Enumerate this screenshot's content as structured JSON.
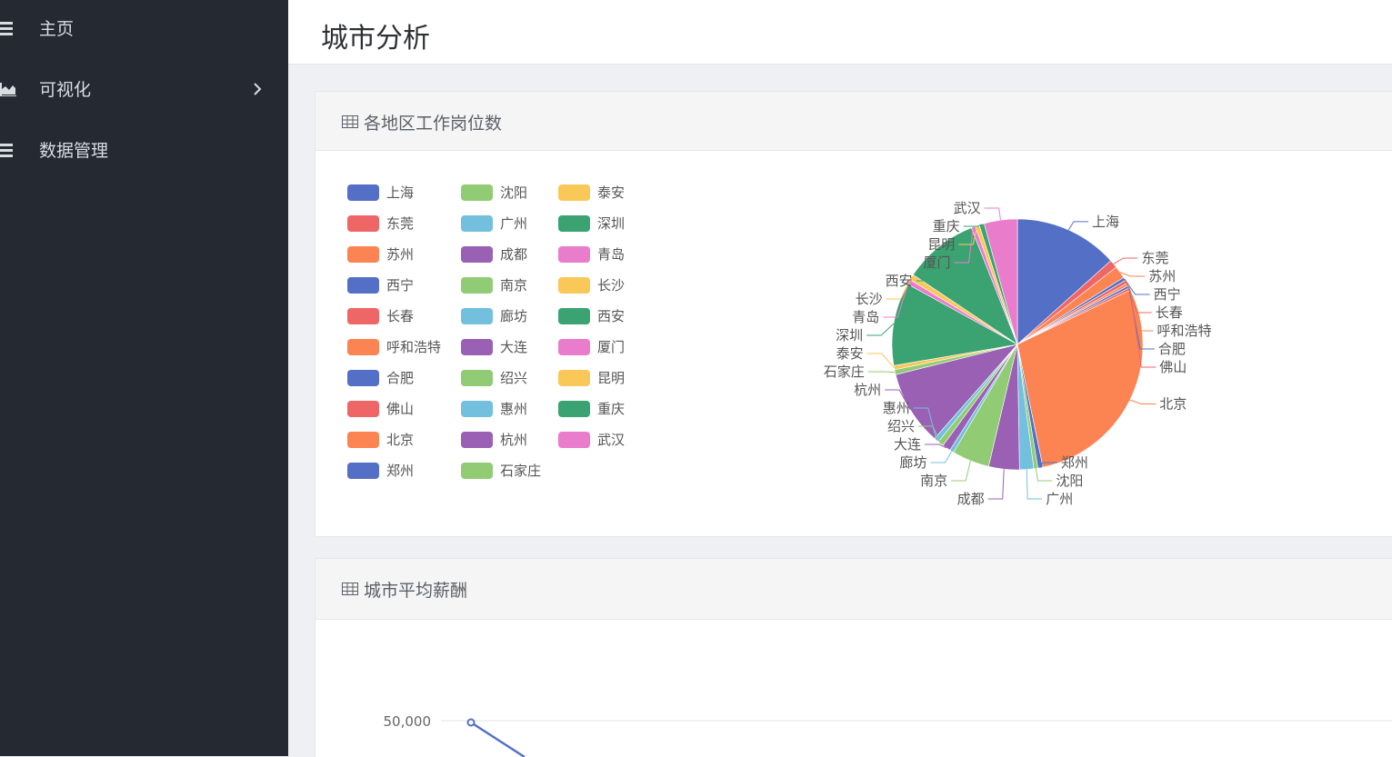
{
  "sidebar": {
    "items": [
      {
        "label": "主页",
        "icon": "menu-icon"
      },
      {
        "label": "可视化",
        "icon": "area-chart-icon",
        "has_submenu": true
      },
      {
        "label": "数据管理",
        "icon": "menu-icon"
      }
    ]
  },
  "header": {
    "title": "城市分析"
  },
  "panels": [
    {
      "title": "各地区工作岗位数",
      "icon": "table-icon"
    },
    {
      "title": "城市平均薪酬",
      "icon": "table-icon"
    }
  ],
  "colors": {
    "sidebar_bg": "#252a32",
    "palette": [
      "#5470c6",
      "#91cc75",
      "#fac858",
      "#ee6666",
      "#73c0de",
      "#3ba272",
      "#fc8452",
      "#9a60b4",
      "#ea7ccc"
    ]
  },
  "chart_data": [
    {
      "type": "pie",
      "legend_position": "left",
      "legend": [
        "上海",
        "沈阳",
        "泰安",
        "东莞",
        "广州",
        "深圳",
        "苏州",
        "成都",
        "青岛",
        "西宁",
        "南京",
        "长沙",
        "长春",
        "廊坊",
        "西安",
        "呼和浩特",
        "大连",
        "厦门",
        "合肥",
        "绍兴",
        "昆明",
        "佛山",
        "惠州",
        "重庆",
        "北京",
        "杭州",
        "武汉",
        "郑州",
        "石家庄"
      ],
      "slices": [
        {
          "name": "上海",
          "value": 12.5
        },
        {
          "name": "东莞",
          "value": 1
        },
        {
          "name": "苏州",
          "value": 1.5
        },
        {
          "name": "西宁",
          "value": 0.4
        },
        {
          "name": "长春",
          "value": 0.4
        },
        {
          "name": "呼和浩特",
          "value": 0.3
        },
        {
          "name": "合肥",
          "value": 0.3
        },
        {
          "name": "佛山",
          "value": 0.3
        },
        {
          "name": "北京",
          "value": 27
        },
        {
          "name": "郑州",
          "value": 0.6
        },
        {
          "name": "沈阳",
          "value": 0.5
        },
        {
          "name": "广州",
          "value": 1.7
        },
        {
          "name": "成都",
          "value": 3.7
        },
        {
          "name": "南京",
          "value": 4.5
        },
        {
          "name": "廊坊",
          "value": 0.5
        },
        {
          "name": "大连",
          "value": 1
        },
        {
          "name": "绍兴",
          "value": 0.7
        },
        {
          "name": "惠州",
          "value": 0.6
        },
        {
          "name": "杭州",
          "value": 9
        },
        {
          "name": "石家庄",
          "value": 0.6
        },
        {
          "name": "泰安",
          "value": 0.5
        },
        {
          "name": "深圳",
          "value": 10
        },
        {
          "name": "青岛",
          "value": 0.6
        },
        {
          "name": "长沙",
          "value": 0.7
        },
        {
          "name": "西安",
          "value": 9
        },
        {
          "name": "厦门",
          "value": 0.5
        },
        {
          "name": "昆明",
          "value": 0.5
        },
        {
          "name": "重庆",
          "value": 0.6
        },
        {
          "name": "武汉",
          "value": 4
        }
      ]
    },
    {
      "type": "line",
      "y_tick_labels": [
        "50,000"
      ],
      "series": [
        {
          "values": [
            50000
          ]
        }
      ]
    }
  ]
}
